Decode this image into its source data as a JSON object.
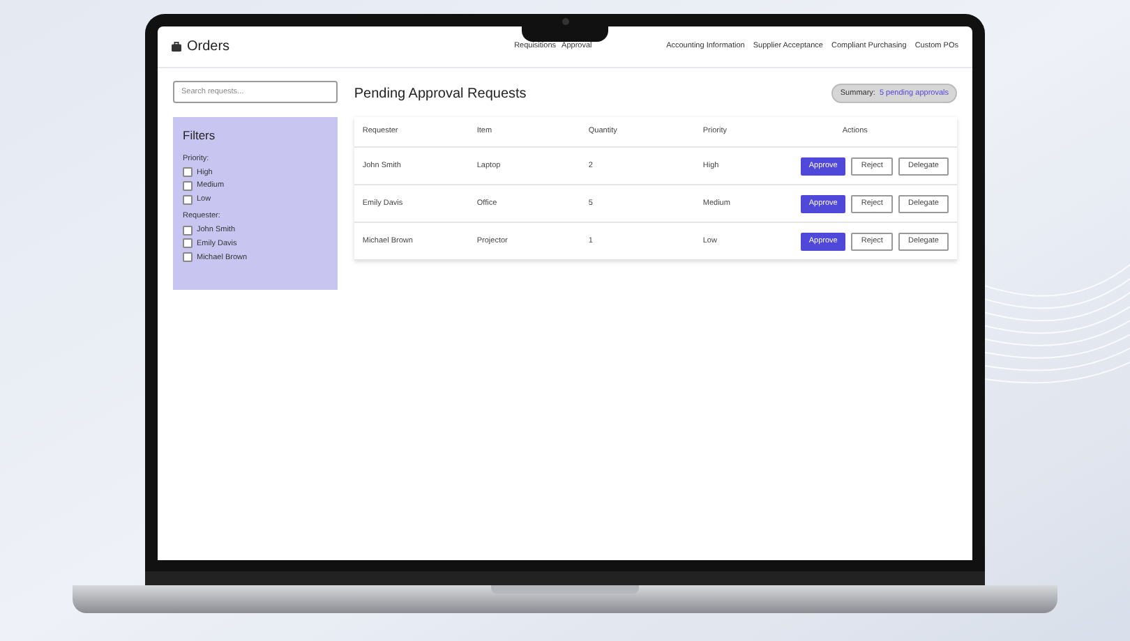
{
  "header": {
    "title": "Orders",
    "nav": [
      "Requisitions",
      "Approval",
      "Accounting Information",
      "Supplier Acceptance",
      "Compliant Purchasing",
      "Custom POs"
    ]
  },
  "search": {
    "placeholder": "Search requests..."
  },
  "filters": {
    "title": "Filters",
    "groups": [
      {
        "label": "Priority:",
        "options": [
          {
            "label": "High",
            "checked": false
          },
          {
            "label": "Medium",
            "checked": false
          },
          {
            "label": "Low",
            "checked": false
          }
        ]
      },
      {
        "label": "Requester:",
        "options": [
          {
            "label": "John Smith",
            "checked": false
          },
          {
            "label": "Emily Davis",
            "checked": false
          },
          {
            "label": "Michael Brown",
            "checked": false
          }
        ]
      }
    ]
  },
  "main": {
    "title": "Pending Approval Requests",
    "summary_label": "Summary:",
    "summary_value": "5 pending approvals"
  },
  "table": {
    "columns": [
      "Requester",
      "Item",
      "Quantity",
      "Priority",
      "Actions"
    ],
    "rows": [
      {
        "requester": "John Smith",
        "item": "Laptop",
        "quantity": "2",
        "priority": "High",
        "actions": [
          "Approve",
          "Reject",
          "Delegate"
        ]
      },
      {
        "requester": "Emily Davis",
        "item": "Office",
        "quantity": "5",
        "priority": "Medium",
        "actions": [
          "Approve",
          "Reject",
          "Delegate"
        ]
      },
      {
        "requester": "Michael Brown",
        "item": "Projector",
        "quantity": "1",
        "priority": "Low",
        "actions": [
          "Approve",
          "Reject",
          "Delegate"
        ]
      }
    ]
  }
}
